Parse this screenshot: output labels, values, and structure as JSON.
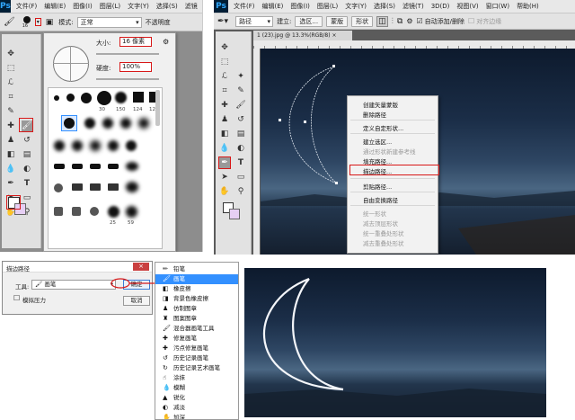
{
  "panel_tl": {
    "menu": [
      "文件(F)",
      "编辑(E)",
      "图像(I)",
      "图层(L)",
      "文字(Y)",
      "选择(S)",
      "滤镜"
    ],
    "brush_size_badge": "16",
    "mode_label": "模式:",
    "mode_value": "正常",
    "opacity_label": "不透明度",
    "size_label": "大小:",
    "size_value": "16 像素",
    "hardness_label": "硬度:",
    "hardness_value": "100%",
    "presets": [
      "30",
      "150",
      "124",
      "124"
    ],
    "presets2": [
      "25",
      "59"
    ]
  },
  "panel_tr": {
    "menu": [
      "文件(F)",
      "编辑(E)",
      "图像(I)",
      "图层(L)",
      "文字(Y)",
      "选择(S)",
      "滤镜(T)",
      "3D(D)",
      "视图(V)",
      "窗口(W)",
      "帮助(H)"
    ],
    "path_mode": "路径",
    "build_label": "建立:",
    "selection_btn": "选区...",
    "mask_btn": "蒙版",
    "shape_btn": "形状",
    "auto_add_delete": "自动添加/删除",
    "align_edges": "对齐边缘",
    "doc_tab": "1 (23).jpg @ 13.3%(RGB/8)",
    "context_menu": {
      "group1": [
        "创建矢量蒙版",
        "删除路径"
      ],
      "group2": [
        "定义自定形状..."
      ],
      "group3": [
        "建立选区...",
        "通过形状新建参考线",
        "填充路径...",
        "描边路径..."
      ],
      "group4": [
        "剪贴路径..."
      ],
      "group5": [
        "自由变换路径"
      ],
      "group6": [
        "统一形状",
        "减去顶层形状",
        "统一重叠处形状",
        "减去重叠处形状"
      ]
    }
  },
  "dialog": {
    "title": "描边路径",
    "tool_label": "工具:",
    "tool_value": "画笔",
    "simulate_pressure": "模拟压力",
    "ok": "确定",
    "cancel": "取消"
  },
  "tool_list": [
    "铅笔",
    "画笔",
    "橡皮擦",
    "背景色橡皮擦",
    "仿制图章",
    "图案图章",
    "混合器画笔工具",
    "修复画笔",
    "污点修复画笔",
    "历史记录画笔",
    "历史记录艺术画笔",
    "涂抹",
    "模糊",
    "锐化",
    "减淡",
    "加深"
  ],
  "tool_list_selected": "画笔",
  "colors": {
    "accent": "#3390ff",
    "redbox": "#d81818",
    "ps_logo": "#31a8ff"
  }
}
